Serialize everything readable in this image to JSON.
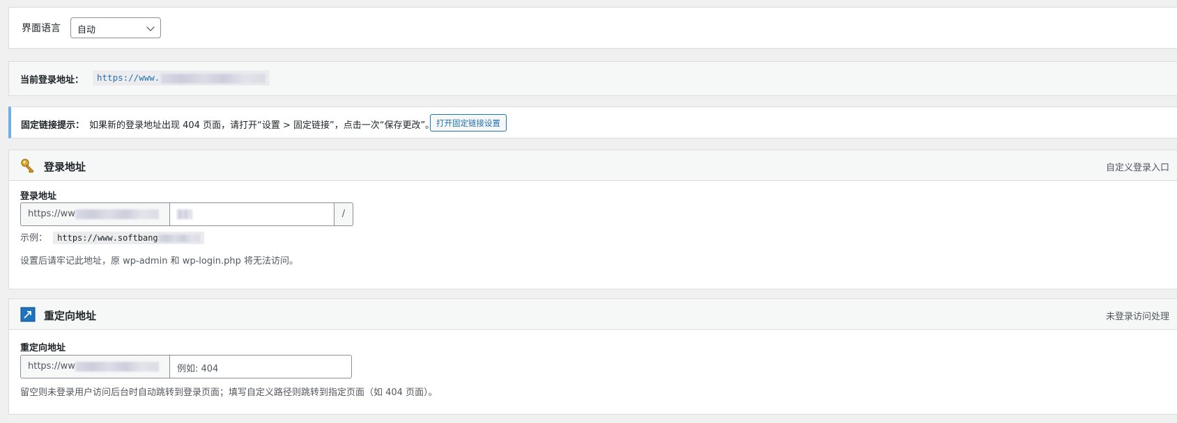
{
  "language": {
    "label": "界面语言",
    "selected": "自动"
  },
  "current_login": {
    "label": "当前登录地址：",
    "url": "https://www."
  },
  "notice": {
    "title": "固定链接提示：",
    "text": "如果新的登录地址出现 404 页面，请打开“设置 > 固定链接”，点击一次“保存更改”。",
    "button": "打开固定链接设置"
  },
  "login_section": {
    "icon": "key-icon",
    "title": "登录地址",
    "aside": "自定义登录入口",
    "field_label": "登录地址",
    "prefix": "https://ww",
    "value": "",
    "suffix": "/",
    "example_label": "示例：",
    "example_url": "https://www.softbang",
    "description": "设置后请牢记此地址，原 wp-admin 和 wp-login.php 将无法访问。"
  },
  "redirect_section": {
    "icon": "redirect-arrow-icon",
    "title": "重定向地址",
    "aside": "未登录访问处理",
    "field_label": "重定向地址",
    "prefix": "https://ww",
    "placeholder": "例如: 404",
    "description": "留空则未登录用户访问后台时自动跳转到登录页面；填写自定义路径则跳转到指定页面（如 404 页面）。"
  },
  "colors": {
    "accent": "#2271b1",
    "notice_border": "#72aee6",
    "icon_blue": "#1e73be",
    "key_gold": "#d69a1e"
  }
}
